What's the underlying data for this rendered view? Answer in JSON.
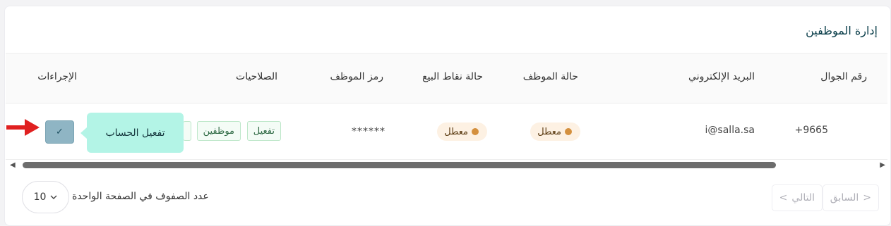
{
  "page": {
    "title": "إدارة الموظفين"
  },
  "table": {
    "headers": [
      "رقم الجوال",
      "البريد الإلكتروني",
      "حالة الموظف",
      "حالة نقاط البيع",
      "رمز الموظف",
      "الصلاحيات",
      "الإجراءات"
    ],
    "row": {
      "phone": "+9665",
      "email": "i@salla.sa",
      "employee_status": "معطل",
      "pos_status": "معطل",
      "employee_code": "******",
      "permissions": [
        "تفعيل",
        "موظفين"
      ],
      "action_icon": "check-icon"
    },
    "status_color": "#d4903e"
  },
  "tooltip": {
    "text": "تفعيل الحساب"
  },
  "pagination": {
    "prev_label": "السابق",
    "next_label": "التالي",
    "rows_per_page_label": "عدد الصفوف في الصفحة الواحدة",
    "rows_per_page_value": "10"
  },
  "colors": {
    "accent_tooltip": "#b3f4e6",
    "action_button": "#8fb5c4",
    "title": "#0a3e4a",
    "annotation_arrow": "#e02020"
  }
}
